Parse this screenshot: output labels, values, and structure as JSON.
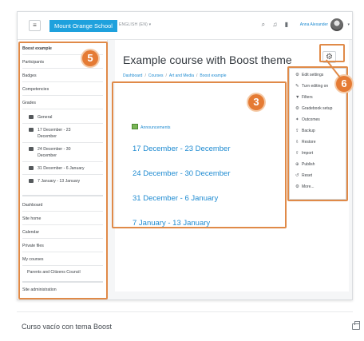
{
  "navbar": {
    "toggle_icon": "≡",
    "site_name": "Mount Orange School",
    "language": "ENGLISH (EN) ▾",
    "icons": [
      "search-icon",
      "bell-icon",
      "chat-icon"
    ],
    "user_name": "Anna Alexander",
    "user_caret": "▾",
    "site_color": "#1ea1dd"
  },
  "drawer": {
    "items": [
      {
        "label": "Boost example"
      },
      {
        "label": "Participants"
      },
      {
        "label": "Badges"
      },
      {
        "label": "Competencies"
      },
      {
        "label": "Grades"
      },
      {
        "label": "General"
      },
      {
        "label": "17 December - 23"
      },
      {
        "label": "December"
      },
      {
        "label": "24 December - 30"
      },
      {
        "label": "December"
      },
      {
        "label": "31 December - 6 January"
      },
      {
        "label": "7 January - 13 January"
      },
      {
        "label": "Dashboard"
      },
      {
        "label": "Site home"
      },
      {
        "label": "Calendar"
      },
      {
        "label": "Private files"
      },
      {
        "label": "My courses"
      },
      {
        "label": "Parents and Citizens Council"
      },
      {
        "label": "Site administration"
      }
    ]
  },
  "main": {
    "title": "Example course with Boost theme",
    "breadcrumb": [
      "Dashboard",
      "Courses",
      "Art and Media",
      "Boost example"
    ],
    "gear_icon": "⚙",
    "announcements": "Announcements",
    "sections": [
      "17 December - 23 December",
      "24 December - 30 December",
      "31 December - 6 January",
      "7 January - 13 January"
    ]
  },
  "menu": {
    "items": [
      {
        "icon": "⚙",
        "label": "Edit settings"
      },
      {
        "icon": "✎",
        "label": "Turn editing on"
      },
      {
        "icon": "▼",
        "label": "Filters"
      },
      {
        "icon": "⚙",
        "label": "Gradebook setup"
      },
      {
        "icon": "✦",
        "label": "Outcomes"
      },
      {
        "icon": "⇪",
        "label": "Backup"
      },
      {
        "icon": "⇩",
        "label": "Restore"
      },
      {
        "icon": "⇧",
        "label": "Import"
      },
      {
        "icon": "⊕",
        "label": "Publish"
      },
      {
        "icon": "↺",
        "label": "Reset"
      },
      {
        "icon": "⚙",
        "label": "More..."
      }
    ]
  },
  "annotations": {
    "badges": [
      "5",
      "3",
      "6"
    ],
    "color": "#e08a48"
  },
  "caption": {
    "text": "Curso vacío con tema Boost"
  }
}
